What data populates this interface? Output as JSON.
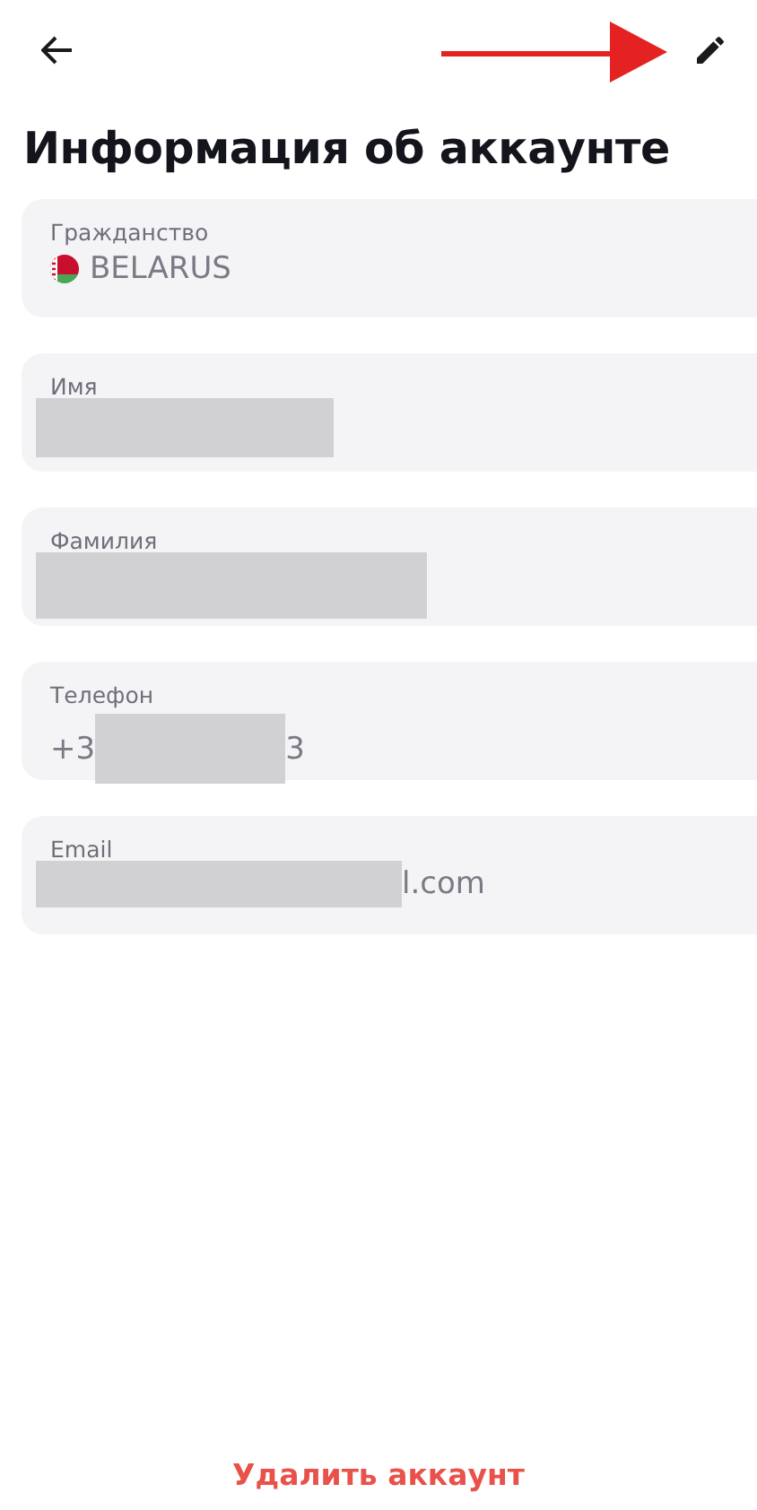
{
  "header": {
    "annotation": {
      "kind": "arrow"
    }
  },
  "title": "Информация об аккаунте",
  "fields": [
    {
      "label": "Гражданство",
      "kind": "country",
      "value": [
        {
          "kind": "text",
          "text": "BELARUS"
        }
      ]
    },
    {
      "label": "Имя",
      "kind": "plain",
      "value": [
        {
          "kind": "redacted"
        }
      ]
    },
    {
      "label": "Фамилия",
      "kind": "plain",
      "value": [
        {
          "kind": "redacted"
        }
      ]
    },
    {
      "label": "Телефон",
      "kind": "plain",
      "value": [
        {
          "kind": "text",
          "text": "+3"
        },
        {
          "kind": "redacted"
        },
        {
          "kind": "text",
          "text": "3"
        }
      ]
    },
    {
      "label": "Email",
      "kind": "plain",
      "value": [
        {
          "kind": "redacted"
        },
        {
          "kind": "text",
          "text": "l.com"
        }
      ]
    }
  ],
  "delete_link": "Удалить аккаунт"
}
